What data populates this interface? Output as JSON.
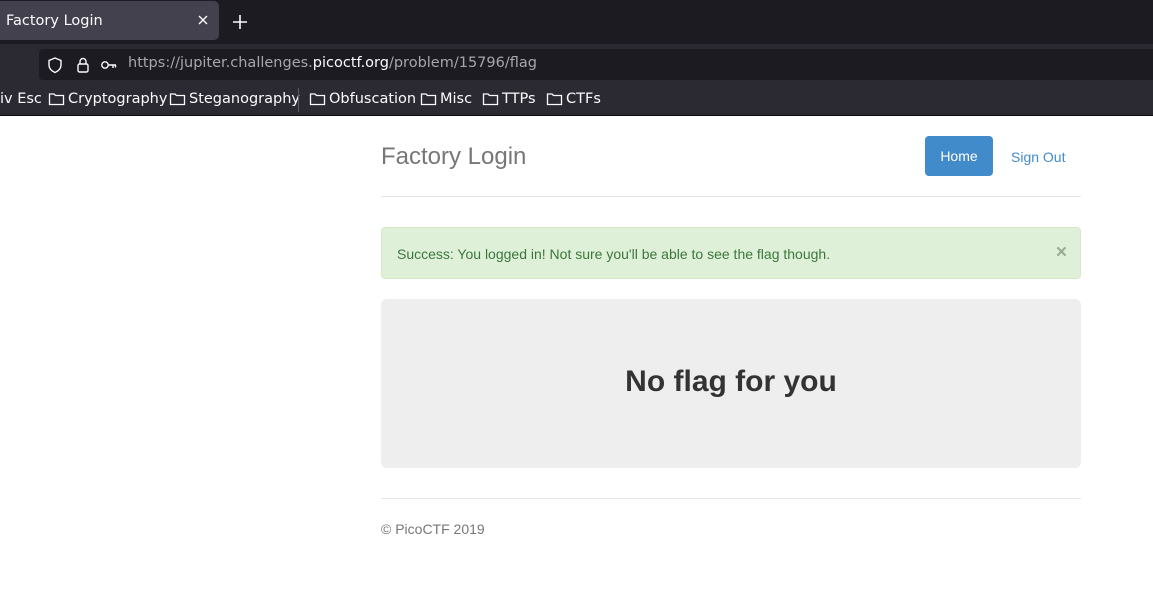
{
  "browser": {
    "tab": {
      "title": "Factory Login"
    },
    "url": {
      "prefix": "https://jupiter.challenges.",
      "domain": "picoctf.org",
      "path": "/problem/15796/flag"
    },
    "bookmarks": [
      {
        "label": "iv Esc",
        "folder": false
      },
      {
        "label": "Cryptography",
        "folder": true
      },
      {
        "label": "Steganography",
        "folder": true
      },
      {
        "label": "Obfuscation",
        "folder": true
      },
      {
        "label": "Misc",
        "folder": true
      },
      {
        "label": "TTPs",
        "folder": true
      },
      {
        "label": "CTFs",
        "folder": true
      }
    ],
    "theme": {
      "tabbar_bg": "#1c1b22",
      "toolbar_bg": "#2b2a33",
      "text": "#fbfbfe"
    }
  },
  "page": {
    "header": {
      "title": "Factory Login",
      "home_label": "Home",
      "signout_label": "Sign Out"
    },
    "alert": {
      "message": "Success: You logged in! Not sure you'll be able to see the flag though.",
      "close_glyph": "×"
    },
    "jumbotron": {
      "text": "No flag for you"
    },
    "footer": {
      "text": "© PicoCTF 2019"
    },
    "colors": {
      "primary": "#428bca",
      "success_bg": "#dff0d8",
      "success_text": "#3c763d",
      "jumbotron_bg": "#eeeeee"
    }
  }
}
